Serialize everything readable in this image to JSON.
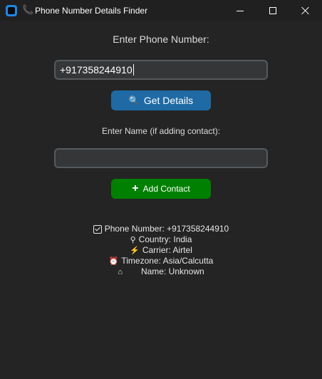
{
  "window": {
    "title": "Phone Number Details Finder",
    "app_icon": "app-icon",
    "title_icon": "phone-icon",
    "controls": [
      "minimize",
      "maximize",
      "close"
    ]
  },
  "form": {
    "phone_label": "Enter Phone Number:",
    "phone_value": "+917358244910",
    "get_details_label": "Get Details",
    "get_details_icon": "magnifier-icon",
    "name_label": "Enter Name (if adding contact):",
    "name_value": "",
    "add_contact_label": "Add Contact",
    "add_contact_icon": "plus-icon"
  },
  "results": {
    "phone_number": "Phone Number: +917358244910",
    "country": "Country: India",
    "carrier": "Carrier: Airtel",
    "timezone": "Timezone: Asia/Calcutta",
    "name": "Name: Unknown"
  },
  "colors": {
    "background": "#242424",
    "titlebar": "#202020",
    "primary_button": "#1f6aa5",
    "add_button": "#008000",
    "input_bg": "#343638",
    "input_border": "#565b5e"
  }
}
